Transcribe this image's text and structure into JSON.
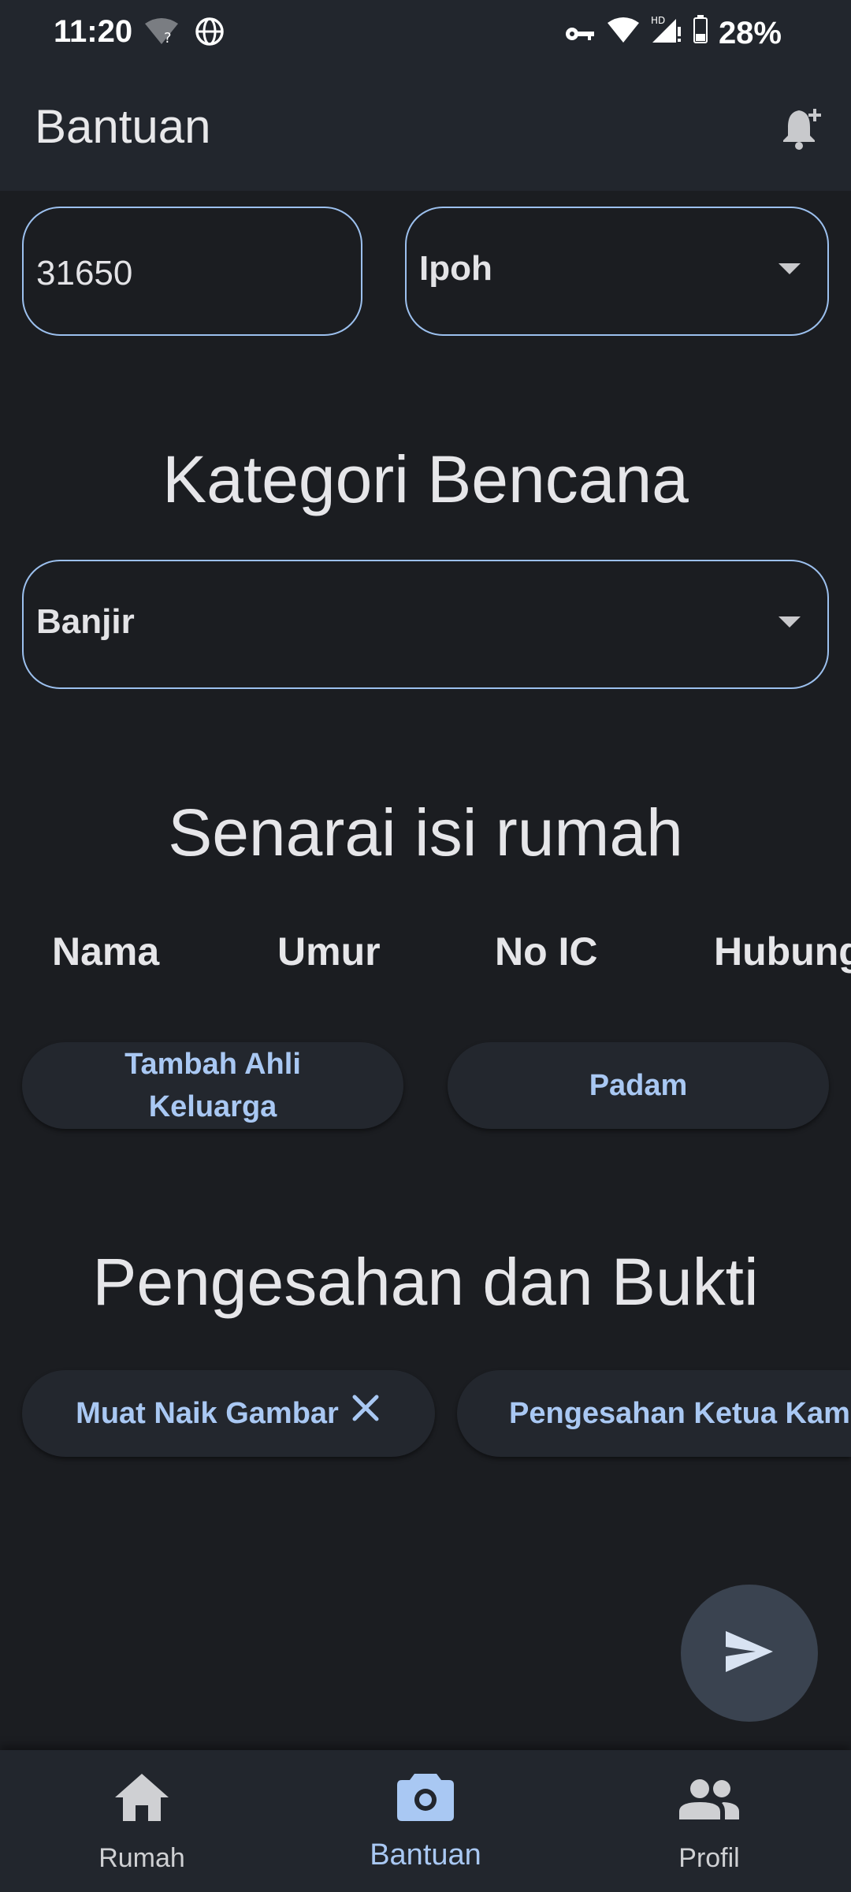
{
  "status_bar": {
    "time": "11:20",
    "battery": "28%"
  },
  "app_bar": {
    "title": "Bantuan"
  },
  "form": {
    "postcode_value": "31650",
    "city_selected": "Ipoh",
    "disaster_section_title": "Kategori Bencana",
    "disaster_selected": "Banjir",
    "household_section_title": "Senarai isi rumah",
    "household_columns": [
      "Nama",
      "Umur",
      "No IC",
      "Hubung"
    ],
    "add_member_label_line1": "Tambah Ahli",
    "add_member_label_line2": "Keluarga",
    "delete_label": "Padam",
    "verification_section_title": "Pengesahan dan Bukti",
    "upload_label": "Muat Naik Gambar",
    "village_head_label": "Pengesahan Ketua Kamp"
  },
  "bottom_nav": {
    "items": [
      {
        "label": "Rumah",
        "icon": "home-icon"
      },
      {
        "label": "Bantuan",
        "icon": "camera-icon"
      },
      {
        "label": "Profil",
        "icon": "people-icon"
      }
    ],
    "active_index": 1
  },
  "colors": {
    "background": "#1b1d21",
    "surface": "#22262d",
    "accent": "#a9c8f3",
    "outline": "#9cc0ee",
    "fab": "#3a4350"
  }
}
